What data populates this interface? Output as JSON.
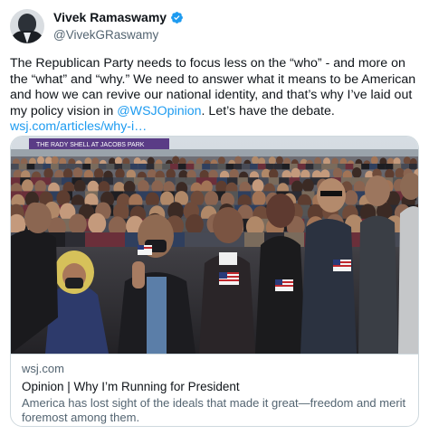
{
  "author": {
    "name": "Vivek Ramaswamy",
    "handle": "@VivekGRaswamy",
    "verified_color": "#1d9bf0",
    "avatar_icon": "profile-photo"
  },
  "tweet": {
    "text_before": "The Republican Party needs to focus less on the “who” - and more on the “what” and “why.” We need to answer what it means to be American and how we can revive our national identity, and that’s why I’ve laid out my policy vision in ",
    "mention": "@WSJOpinion",
    "text_after": ". Let’s have the debate.",
    "link": "wsj.com/articles/why-i…",
    "link_color": "#1d9bf0"
  },
  "card": {
    "image_sign": "THE RADY SHELL AT JACOBS PARK",
    "domain": "wsj.com",
    "title": "Opinion | Why I’m Running for President",
    "description": "America has lost sight of the ideals that made it great—freedom and merit foremost among them."
  }
}
